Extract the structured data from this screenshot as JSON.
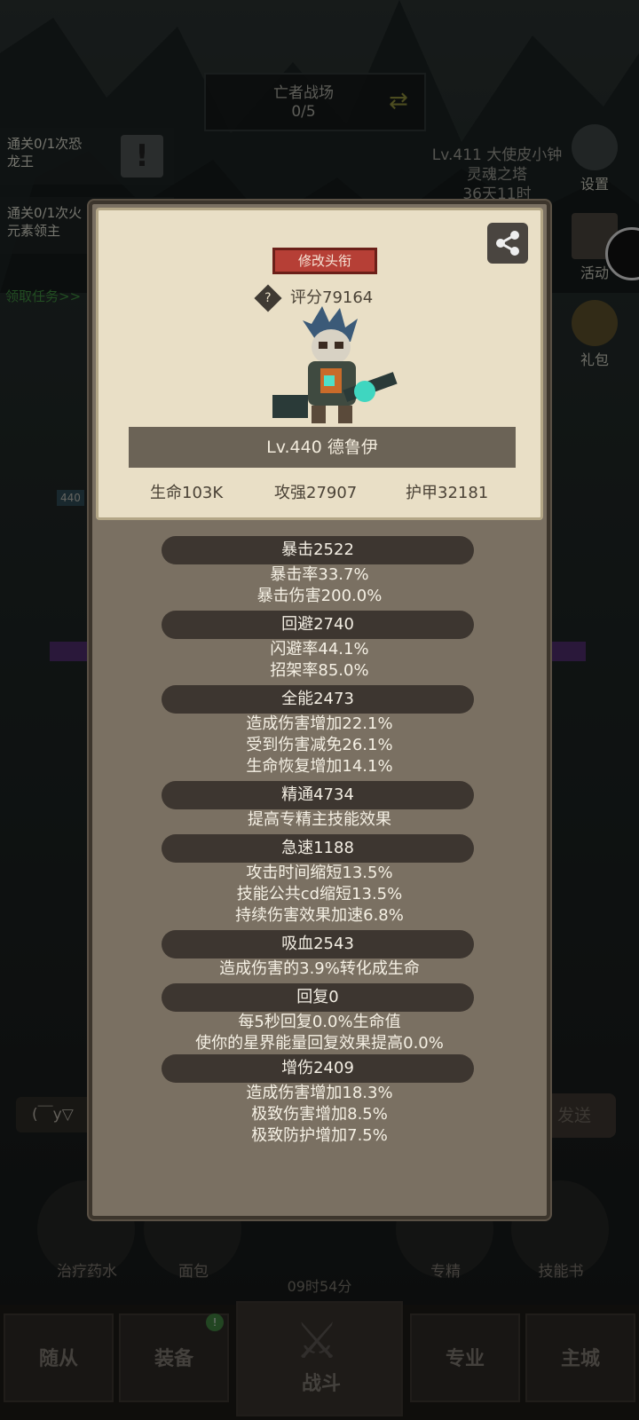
{
  "background": {
    "top_banner": {
      "title": "亡者战场",
      "progress": "0/5"
    },
    "quests": [
      {
        "line1": "通关0/1次恐",
        "line2": "龙王"
      },
      {
        "line1": "通关0/1次火",
        "line2": "元素领主"
      }
    ],
    "quest_link": "领取任务>>",
    "player_info": {
      "line1": "Lv.411 大使皮小钟",
      "line2": "灵魂之塔",
      "line3": "36天11时"
    },
    "side_buttons": [
      "设置",
      "活动",
      "礼包"
    ],
    "level_badge": "440",
    "chat_input": "(￣y▽",
    "send_label": "发送",
    "items": [
      "治疗药水",
      "面包",
      "专精",
      "技能书"
    ],
    "timer": "09时54分",
    "nav": [
      "随从",
      "装备",
      "战斗",
      "专业",
      "主城"
    ]
  },
  "dialog": {
    "title_button": "修改头衔",
    "score": "评分79164",
    "character_name": "Lv.440 德鲁伊",
    "stats": {
      "hp": "生命103K",
      "attack": "攻强27907",
      "armor": "护甲32181"
    },
    "sections": [
      {
        "header": "暴击2522",
        "lines": [
          "暴击率33.7%",
          "暴击伤害200.0%"
        ]
      },
      {
        "header": "回避2740",
        "lines": [
          "闪避率44.1%",
          "招架率85.0%"
        ]
      },
      {
        "header": "全能2473",
        "lines": [
          "造成伤害增加22.1%",
          "受到伤害减免26.1%",
          "生命恢复增加14.1%"
        ]
      },
      {
        "header": "精通4734",
        "lines": [
          "提高专精主技能效果"
        ]
      },
      {
        "header": "急速1188",
        "lines": [
          "攻击时间缩短13.5%",
          "技能公共cd缩短13.5%",
          "持续伤害效果加速6.8%"
        ]
      },
      {
        "header": "吸血2543",
        "lines": [
          "造成伤害的3.9%转化成生命"
        ]
      },
      {
        "header": "回复0",
        "lines": [
          "每5秒回复0.0%生命值",
          "使你的星界能量回复效果提高0.0%"
        ]
      },
      {
        "header": "增伤2409",
        "lines": [
          "造成伤害增加18.3%",
          "极致伤害增加8.5%",
          "极致防护增加7.5%"
        ]
      }
    ]
  }
}
